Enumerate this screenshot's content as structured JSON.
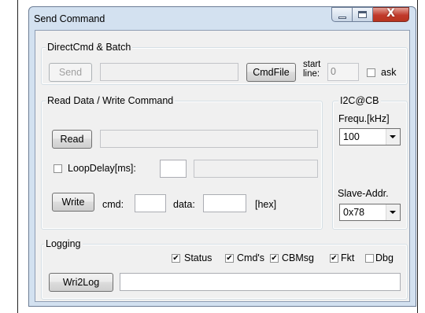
{
  "window": {
    "title": "Send Command",
    "close_glyph": "X"
  },
  "direct": {
    "legend": "DirectCmd & Batch",
    "send_label": "Send",
    "command_value": "",
    "cmdfile_label": "CmdFile",
    "start_line_label_1": "start",
    "start_line_label_2": "line:",
    "start_line_value": "0",
    "ask_label": "ask",
    "ask_checked": false
  },
  "readwrite": {
    "legend": "Read Data / Write Command",
    "read_label": "Read",
    "read_value": "",
    "loop_delay_label": "LoopDelay[ms]:",
    "loop_delay_checked": false,
    "loop_delay_value": "",
    "loop_status_value": "",
    "write_label": "Write",
    "cmd_label": "cmd:",
    "cmd_value": "",
    "data_label": "data:",
    "data_value": "",
    "hex_label": "[hex]"
  },
  "i2c": {
    "legend": "I2C@CB",
    "freq_label": "Frequ.[kHz]",
    "freq_value": "100",
    "slave_label": "Slave-Addr.",
    "slave_value": "0x78"
  },
  "logging": {
    "legend": "Logging",
    "checkboxes": [
      {
        "label": "Status",
        "checked": true
      },
      {
        "label": "Cmd's",
        "checked": true
      },
      {
        "label": "CBMsg",
        "checked": true
      },
      {
        "label": "Fkt",
        "checked": true
      },
      {
        "label": "Dbg",
        "checked": false
      }
    ],
    "wri2log_label": "Wri2Log",
    "log_value": ""
  },
  "icons": {
    "minimize": "minimize-icon",
    "maximize": "maximize-icon",
    "close": "close-icon",
    "dropdown": "chevron-down-icon",
    "check_mark": "✔"
  }
}
